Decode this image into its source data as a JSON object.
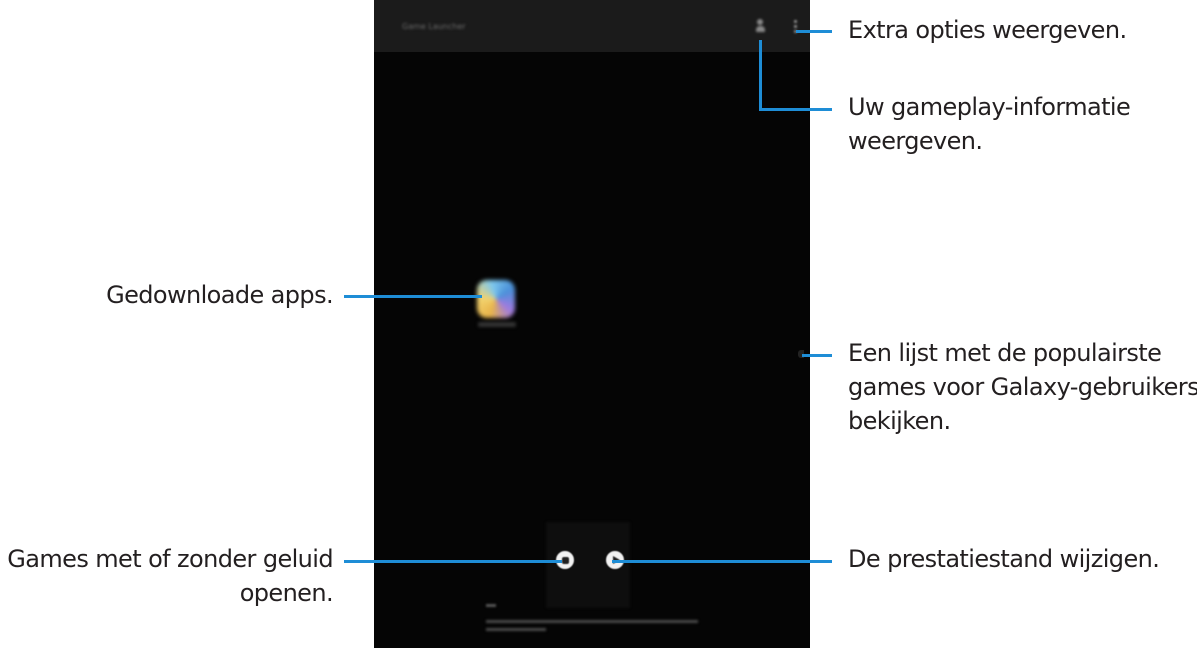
{
  "screen": {
    "title": "Game Launcher"
  },
  "callouts": {
    "more_options": "Extra opties weergeven.",
    "gameplay_info_1": "Uw gameplay-informatie",
    "gameplay_info_2": "weergeven.",
    "downloaded_apps": "Gedownloade apps.",
    "popular_games_1": "Een lijst met de populairste",
    "popular_games_2": "games voor Galaxy-gebruikers",
    "popular_games_3": "bekijken.",
    "sound_1": "Games met of zonder geluid",
    "sound_2": "openen.",
    "performance": "De prestatiestand wijzigen."
  },
  "colors": {
    "leader_line": "#1e8dd6",
    "screen_bg": "#050505",
    "text": "#231f20"
  },
  "icons": {
    "stats": "person-icon",
    "more": "more-vertical-icon",
    "mute": "mute-icon",
    "performance": "play-icon"
  }
}
